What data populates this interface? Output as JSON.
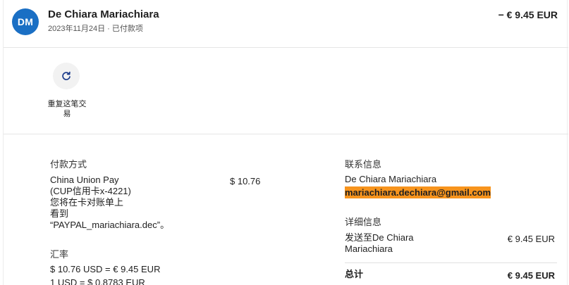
{
  "header": {
    "avatar_initials": "DM",
    "merchant_name": "De Chiara Mariachiara",
    "date_status": "2023年11月24日 · 已付款项",
    "amount": "− € 9.45 EUR"
  },
  "actions": {
    "repeat_label": "重复这笔交易",
    "repeat_icon": "refresh-icon"
  },
  "payment": {
    "heading": "付款方式",
    "method_line1": "China Union Pay",
    "method_line2": "(CUP信用卡x-4221)",
    "method_line3": "您将在卡对账单上",
    "method_line4": "看到",
    "method_line5": "“PAYPAL_mariachiara.dec”。",
    "method_amount": "$ 10.76"
  },
  "exchange": {
    "heading": "汇率",
    "line1": "$ 10.76 USD = € 9.45 EUR",
    "line2": "1 USD = $ 0.8783 EUR"
  },
  "contact": {
    "heading": "联系信息",
    "name": "De Chiara Mariachiara",
    "email": "mariachiara.dechiara@gmail.com"
  },
  "details": {
    "heading": "详细信息",
    "sent_to_line1": "发送至De Chiara",
    "sent_to_line2": "Mariachiara",
    "sent_amount": "€ 9.45 EUR",
    "total_label": "总计",
    "total_amount": "€ 9.45 EUR"
  },
  "colors": {
    "avatar_bg": "#1a6fc4",
    "email_highlight": "#f7941d"
  }
}
